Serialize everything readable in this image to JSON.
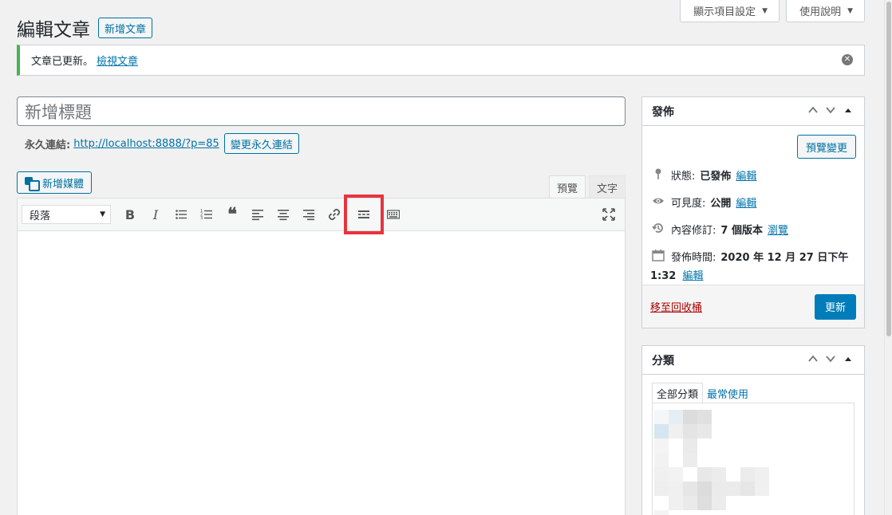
{
  "screen_meta": {
    "options_label": "顯示項目設定",
    "help_label": "使用說明"
  },
  "header": {
    "title": "編輯文章",
    "add_new_label": "新增文章"
  },
  "notice": {
    "text": "文章已更新。",
    "link": "檢視文章"
  },
  "post": {
    "title_placeholder": "新增標題",
    "permalink_label": "永久連結:",
    "permalink_url": "http://localhost:8888/?p=85",
    "change_permalink_label": "變更永久連結"
  },
  "editor": {
    "add_media_label": "新增媒體",
    "tabs": [
      "預覽",
      "文字"
    ],
    "format_select": "段落",
    "toolbar_icons": [
      "bold-icon",
      "italic-icon",
      "bullet-list-icon",
      "numbered-list-icon",
      "blockquote-icon",
      "align-left-icon",
      "align-center-icon",
      "align-right-icon",
      "link-icon",
      "read-more-icon",
      "toolbar-toggle-icon",
      "fullscreen-icon"
    ],
    "highlight_color": "#e8343f"
  },
  "publish": {
    "title": "發佈",
    "preview_label": "預覽變更",
    "status_label": "狀態:",
    "status_value": "已發佈",
    "visibility_label": "可見度:",
    "visibility_value": "公開",
    "revisions_label": "內容修訂:",
    "revisions_value": "7 個版本",
    "edit_link": "編輯",
    "browse_link": "瀏覽",
    "published_label": "發佈時間:",
    "published_value_1": "2020 年 12 月 27 日下午",
    "published_value_2": "1:32",
    "trash_label": "移至回收桶",
    "update_label": "更新"
  },
  "categories": {
    "title": "分類",
    "tab_all": "全部分類",
    "tab_popular": "最常使用"
  },
  "colors": {
    "primary": "#007cba",
    "link": "#0073aa",
    "success": "#46b450",
    "trash": "#a00"
  }
}
